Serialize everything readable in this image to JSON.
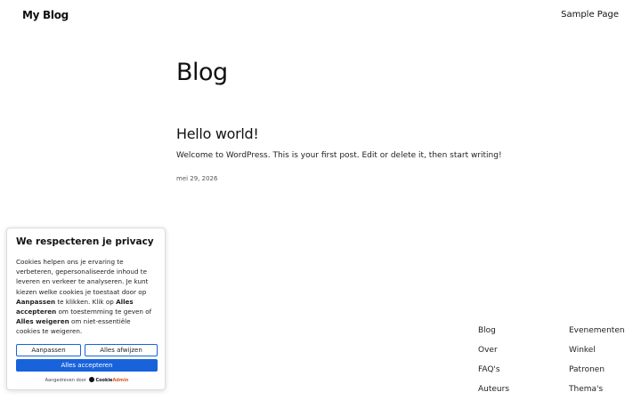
{
  "header": {
    "site_title": "My Blog",
    "nav_link": "Sample Page"
  },
  "main": {
    "page_heading": "Blog",
    "post": {
      "title": "Hello world!",
      "excerpt": "Welcome to WordPress. This is your first post. Edit or delete it, then start writing!",
      "date": "mei 29, 2026"
    }
  },
  "footer": {
    "links_col1": [
      "Blog",
      "Over",
      "FAQ's",
      "Auteurs"
    ],
    "links_col2": [
      "Evenementen",
      "Winkel",
      "Patronen",
      "Thema's"
    ]
  },
  "cookie_banner": {
    "title": "We respecteren je privacy",
    "text_1": "Cookies helpen ons je ervaring te verbeteren, gepersonaliseerde inhoud te leveren en verkeer te analyseren. Je kunt kiezen welke cookies je toestaat door op ",
    "bold_customize": "Aanpassen",
    "text_2": " te klikken. Klik op ",
    "bold_accept_all": "Alles accepteren",
    "text_3": " om toestemming te geven of ",
    "bold_reject_all": "Alles weigeren",
    "text_4": " om niet-essentiële cookies te weigeren.",
    "customize_label": "Aanpassen",
    "reject_label": "Alles afwijzen",
    "accept_label": "Alles accepteren",
    "powered_by": "Aangedreven door",
    "brand_part1": "Cookie",
    "brand_part2": "Admin",
    "accent_color": "#1863dc"
  }
}
